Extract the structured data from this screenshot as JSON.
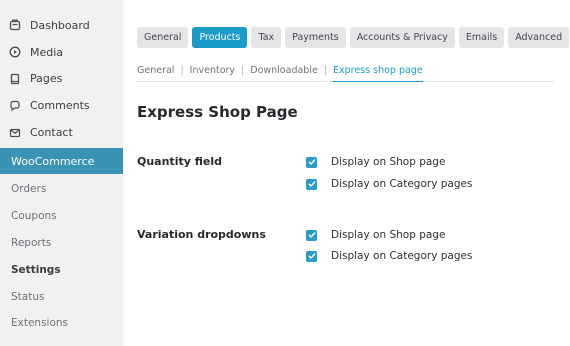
{
  "sidebar": {
    "top_items": [
      {
        "label": "Dashboard",
        "icon": "dashboard-icon"
      },
      {
        "label": "Media",
        "icon": "media-icon"
      },
      {
        "label": "Pages",
        "icon": "pages-icon"
      },
      {
        "label": "Comments",
        "icon": "comments-icon"
      },
      {
        "label": "Contact",
        "icon": "contact-icon"
      }
    ],
    "active_section": "WooCommerce",
    "sub_items": [
      {
        "label": "Orders"
      },
      {
        "label": "Coupons"
      },
      {
        "label": "Reports"
      },
      {
        "label": "Settings",
        "active": true
      },
      {
        "label": "Status"
      },
      {
        "label": "Extensions"
      }
    ]
  },
  "tabs": [
    {
      "label": "General"
    },
    {
      "label": "Products",
      "active": true
    },
    {
      "label": "Tax"
    },
    {
      "label": "Payments"
    },
    {
      "label": "Accounts & Privacy"
    },
    {
      "label": "Emails"
    },
    {
      "label": "Advanced"
    }
  ],
  "subnav": [
    {
      "label": "General"
    },
    {
      "label": "Inventory"
    },
    {
      "label": "Downloadable"
    },
    {
      "label": "Express shop page",
      "current": true
    }
  ],
  "page_title": "Express Shop Page",
  "fields": [
    {
      "label": "Quantity field",
      "options": [
        {
          "label": "Display on Shop page",
          "checked": true
        },
        {
          "label": "Display on Category pages",
          "checked": true
        }
      ]
    },
    {
      "label": "Variation dropdowns",
      "options": [
        {
          "label": "Display on Shop page",
          "checked": true
        },
        {
          "label": "Display on Category pages",
          "checked": true
        }
      ]
    }
  ],
  "colors": {
    "accent": "#1a9cc8",
    "sidebar_active": "#3a93b4",
    "sidebar_bg": "#f1f1f2",
    "tab_bg": "#e4e5e7"
  }
}
